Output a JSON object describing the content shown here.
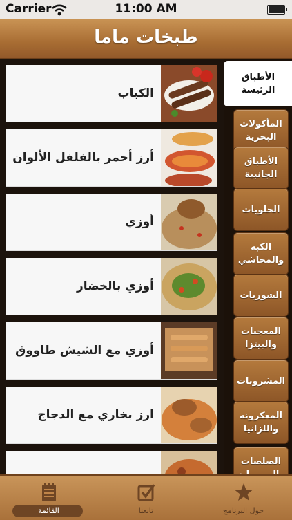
{
  "status_bar": {
    "carrier": "Carrier",
    "time": "11:00 AM"
  },
  "header": {
    "title": "طبخات ماما"
  },
  "dishes": [
    {
      "name": "الكباب"
    },
    {
      "name": "أرز أحمر بالفلفل الألوان"
    },
    {
      "name": "أوزي"
    },
    {
      "name": "أوزي بالخضار"
    },
    {
      "name": "أوزي مع الشيش طاووق"
    },
    {
      "name": "ارز بخاري مع الدجاج"
    },
    {
      "name": ""
    }
  ],
  "categories": [
    {
      "label": "الأطباق الرئيسة",
      "active": true
    },
    {
      "label": "المأكولات البحرية"
    },
    {
      "label": "الأطباق الجانبية"
    },
    {
      "label": "الحلويات"
    },
    {
      "label": "الكبه والمحاشي"
    },
    {
      "label": "الشوربات"
    },
    {
      "label": "المعجنات والبيتزا"
    },
    {
      "label": "المشروبات"
    },
    {
      "label": "المعكرونه واللزانيا"
    },
    {
      "label": "الصلصات والصوصات"
    }
  ],
  "tabs": [
    {
      "label": "القائمة",
      "icon": "notepad-icon",
      "active": true
    },
    {
      "label": "تابعنا",
      "icon": "checkbox-icon"
    },
    {
      "label": "حول البرنامج",
      "icon": "star-icon"
    }
  ],
  "colors": {
    "header": "#b47a3d",
    "tabbar": "#c08549",
    "sidebar_button": "#a16832",
    "background": "#1c130c"
  }
}
